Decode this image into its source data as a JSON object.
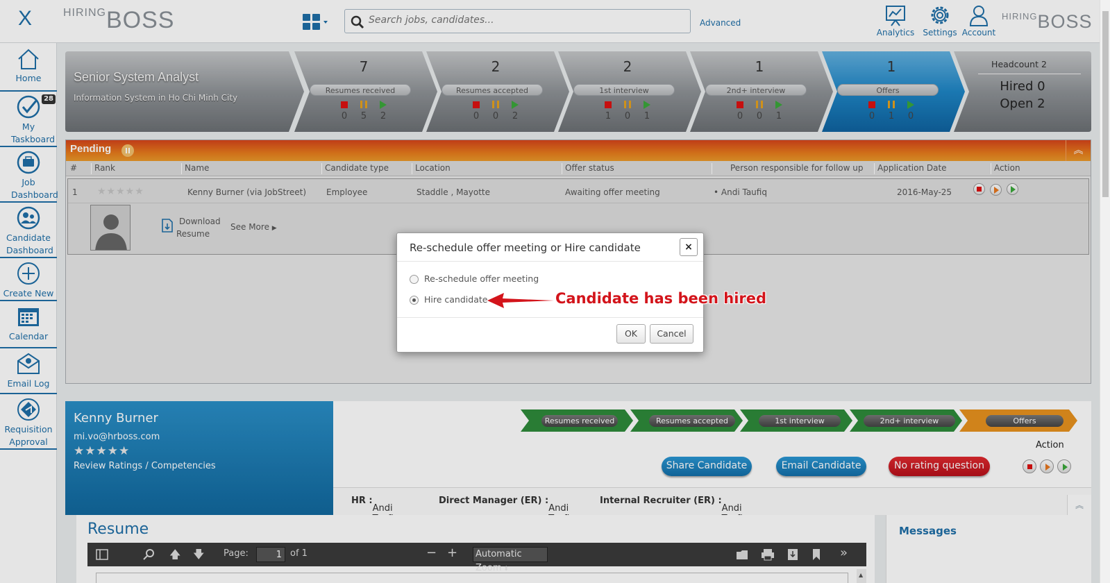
{
  "topbar": {
    "close_label": "X",
    "logo_hiring": "HIRING",
    "logo_boss": "BOSS",
    "search_placeholder": "Search jobs, candidates...",
    "advanced_label": "Advanced",
    "analytics_label": "Analytics",
    "settings_label": "Settings",
    "account_label": "Account"
  },
  "sidebar": {
    "items": [
      {
        "label": "Home"
      },
      {
        "label": "My Taskboard",
        "badge": "28"
      },
      {
        "label": "Job Dashboard"
      },
      {
        "label": "Candidate Dashboard"
      },
      {
        "label": "Create New"
      },
      {
        "label": "Calendar"
      },
      {
        "label": "Email Log"
      },
      {
        "label": "Requisition Approval"
      }
    ]
  },
  "job": {
    "title": "Senior System Analyst",
    "subtitle": "Information System in Ho Chi Minh City"
  },
  "pipeline": [
    {
      "count": "7",
      "label": "Resumes received",
      "stopped": "0",
      "paused": "5",
      "active": "2"
    },
    {
      "count": "2",
      "label": "Resumes accepted",
      "stopped": "0",
      "paused": "0",
      "active": "2"
    },
    {
      "count": "2",
      "label": "1st interview",
      "stopped": "1",
      "paused": "0",
      "active": "1"
    },
    {
      "count": "1",
      "label": "2nd+ interview",
      "stopped": "0",
      "paused": "0",
      "active": "1"
    },
    {
      "count": "1",
      "label": "Offers",
      "stopped": "0",
      "paused": "1",
      "active": "0"
    }
  ],
  "headcount": {
    "title": "Headcount 2",
    "hired": "Hired 0",
    "open": "Open 2"
  },
  "pending": {
    "title": "Pending",
    "columns": [
      "#",
      "Rank",
      "Name",
      "Candidate type",
      "Location",
      "Offer status",
      "Person responsible for follow up",
      "Application Date",
      "Action"
    ],
    "row": {
      "num": "1",
      "stars": "★★★★★",
      "name": "Kenny Burner (via JobStreet)",
      "type": "Employee",
      "location": "Staddle , Mayotte",
      "status": "Awaiting offer meeting",
      "person": "• Andi Taufiq",
      "date": "2016-May-25",
      "download_line1": "Download",
      "download_line2": "Resume",
      "see_more": "See More"
    }
  },
  "modal": {
    "title": "Re-schedule offer meeting or Hire candidate",
    "close_label": "×",
    "option1": "Re-schedule offer meeting",
    "option2": "Hire candidate",
    "ok_label": "OK",
    "cancel_label": "Cancel"
  },
  "annotation": "Candidate has been hired",
  "candidate": {
    "name": "Kenny Burner",
    "email": "mi.vo@hrboss.com",
    "stars": "★★★★★",
    "review_label": "Review Ratings / Competencies",
    "stages": [
      "Resumes received",
      "Resumes accepted",
      "1st interview",
      "2nd+ interview",
      "Offers"
    ],
    "share_label": "Share Candidate",
    "email_label": "Email Candidate",
    "rating_label": "No rating question",
    "action_label": "Action",
    "hr_key": "HR :",
    "hr_val": "Andi Taufiq",
    "dm_key": "Direct Manager (ER) :",
    "dm_val": "Andi Taufiq",
    "ir_key": "Internal Recruiter (ER) :",
    "ir_val": "Andi Taufiq"
  },
  "resume": {
    "title": "Resume",
    "page_label": "Page:",
    "page_value": "1",
    "page_of": "of 1",
    "zoom_label": "Automatic Zoom"
  },
  "messages": {
    "title": "Messages"
  },
  "colors": {
    "brand_blue": "#1f6fa8",
    "pending_orange": "#e77b1c",
    "stage_green": "#2e8b3a",
    "offers_blue": "#1679b8",
    "rating_red": "#c9141b"
  }
}
